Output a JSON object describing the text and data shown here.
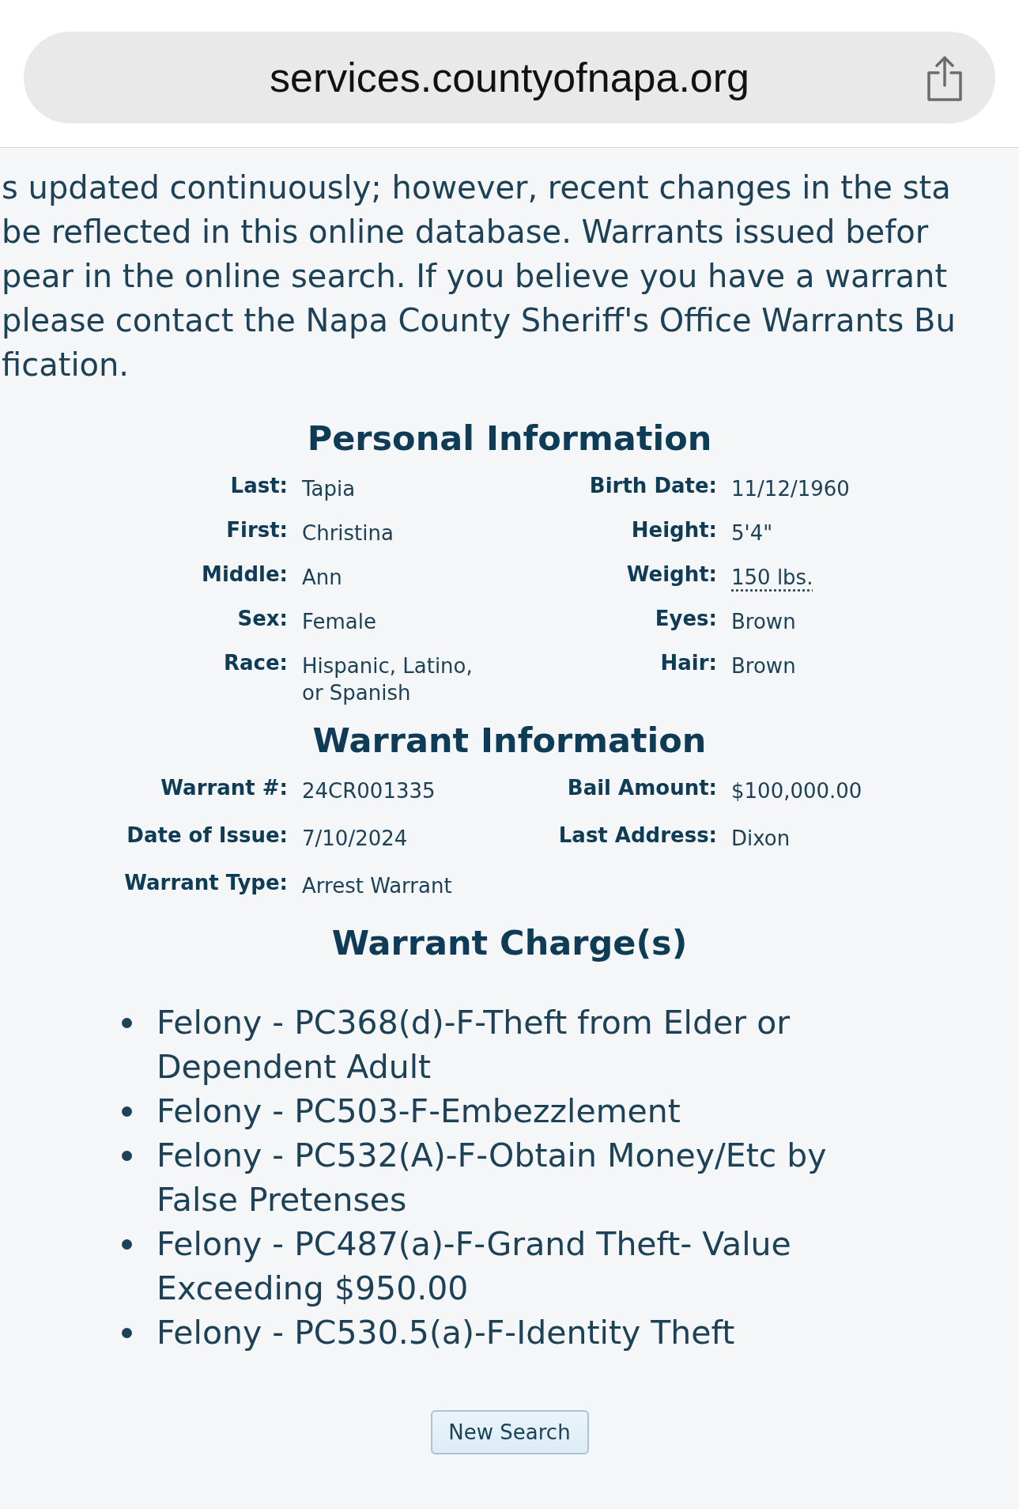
{
  "address_bar": {
    "url": "services.countyofnapa.org"
  },
  "notice_lines": [
    "s updated continuously; however, recent changes in the sta",
    "be reflected in this online database. Warrants issued befor",
    "pear in the online search. If you believe you have a warrant",
    "please contact the Napa County Sheriff's Office Warrants Bu",
    "fication."
  ],
  "personal_information": {
    "title": "Personal Information",
    "fields": [
      {
        "label": "Last:",
        "value": "Tapia",
        "kind": "plain"
      },
      {
        "label": "Birth Date:",
        "value": "11/12/1960",
        "kind": "plain"
      },
      {
        "label": "First:",
        "value": "Christina",
        "kind": "plain"
      },
      {
        "label": "Height:",
        "value": "5'4\"",
        "kind": "plain"
      },
      {
        "label": "Middle:",
        "value": "Ann",
        "kind": "plain"
      },
      {
        "label": "Weight:",
        "value": "150 lbs.",
        "kind": "abbr"
      },
      {
        "label": "Sex:",
        "value": "Female",
        "kind": "plain"
      },
      {
        "label": "Eyes:",
        "value": "Brown",
        "kind": "plain"
      },
      {
        "label": "Race:",
        "value": "Hispanic, Latino, or Spanish",
        "kind": "plain"
      },
      {
        "label": "Hair:",
        "value": "Brown",
        "kind": "plain"
      }
    ]
  },
  "warrant_information": {
    "title": "Warrant Information",
    "fields": [
      {
        "label": "Warrant #:",
        "value": "24CR001335"
      },
      {
        "label": "Bail Amount:",
        "value": "$100,000.00"
      },
      {
        "label": "Date of Issue:",
        "value": "7/10/2024"
      },
      {
        "label": "Last Address:",
        "value": "Dixon"
      },
      {
        "label": "Warrant Type:",
        "value": "Arrest Warrant"
      }
    ]
  },
  "warrant_charges": {
    "title": "Warrant Charge(s)",
    "items": [
      "Felony - PC368(d)-F-Theft from Elder or Dependent Adult",
      "Felony - PC503-F-Embezzlement",
      "Felony - PC532(A)-F-Obtain Money/Etc by False Pretenses",
      "Felony - PC487(a)-F-Grand Theft- Value Exceeding $950.00",
      "Felony - PC530.5(a)-F-Identity Theft"
    ]
  },
  "button": {
    "label": "New Search"
  }
}
